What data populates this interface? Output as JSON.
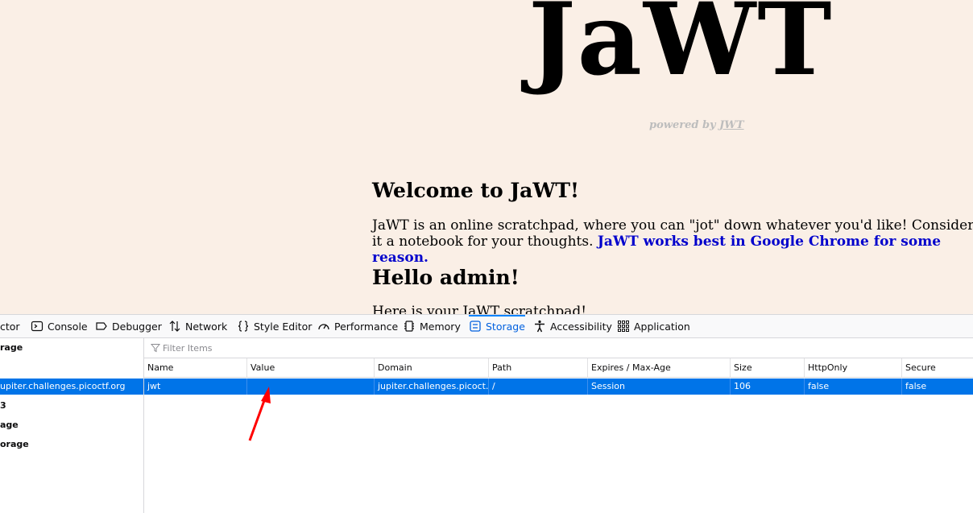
{
  "page": {
    "logo": "JaWT",
    "powered_prefix": "powered by ",
    "powered_link": "JWT",
    "welcome_heading": "Welcome to JaWT!",
    "intro_text": " JaWT is an online scratchpad, where you can \"jot\" down whatever you'd like! Consider it a notebook for your thoughts. ",
    "chrome_note": "JaWT works best in Google Chrome for some reason.",
    "hello_heading": "Hello admin!",
    "scratchpad_prefix": " Here is your ",
    "scratchpad_link": "JaWT scratchpad",
    "scratchpad_suffix": "!"
  },
  "devtools": {
    "tabs": [
      {
        "label": "ctor",
        "icon": "inspector-icon"
      },
      {
        "label": "Console",
        "icon": "console-icon"
      },
      {
        "label": "Debugger",
        "icon": "debugger-icon"
      },
      {
        "label": "Network",
        "icon": "network-icon"
      },
      {
        "label": "Style Editor",
        "icon": "style-editor-icon"
      },
      {
        "label": "Performance",
        "icon": "performance-icon"
      },
      {
        "label": "Memory",
        "icon": "memory-icon"
      },
      {
        "label": "Storage",
        "icon": "storage-icon",
        "active": true
      },
      {
        "label": "Accessibility",
        "icon": "accessibility-icon"
      },
      {
        "label": "Application",
        "icon": "application-icon"
      }
    ],
    "sidebar": [
      {
        "label": "rage",
        "bold": true
      },
      {
        "label": "upiter.challenges.picoctf.org",
        "selected": true
      },
      {
        "label": "3",
        "bold": true
      },
      {
        "label": "age",
        "bold": true
      },
      {
        "label": "orage",
        "bold": true
      }
    ],
    "filter_placeholder": "Filter Items",
    "columns": [
      "Name",
      "Value",
      "Domain",
      "Path",
      "Expires / Max-Age",
      "Size",
      "HttpOnly",
      "Secure"
    ],
    "rows": [
      [
        "jwt",
        "",
        "jupiter.challenges.picoct…",
        "/",
        "Session",
        "106",
        "false",
        "false"
      ]
    ],
    "accent_color": "#0074e8",
    "annotation_color": "#ff0000"
  }
}
